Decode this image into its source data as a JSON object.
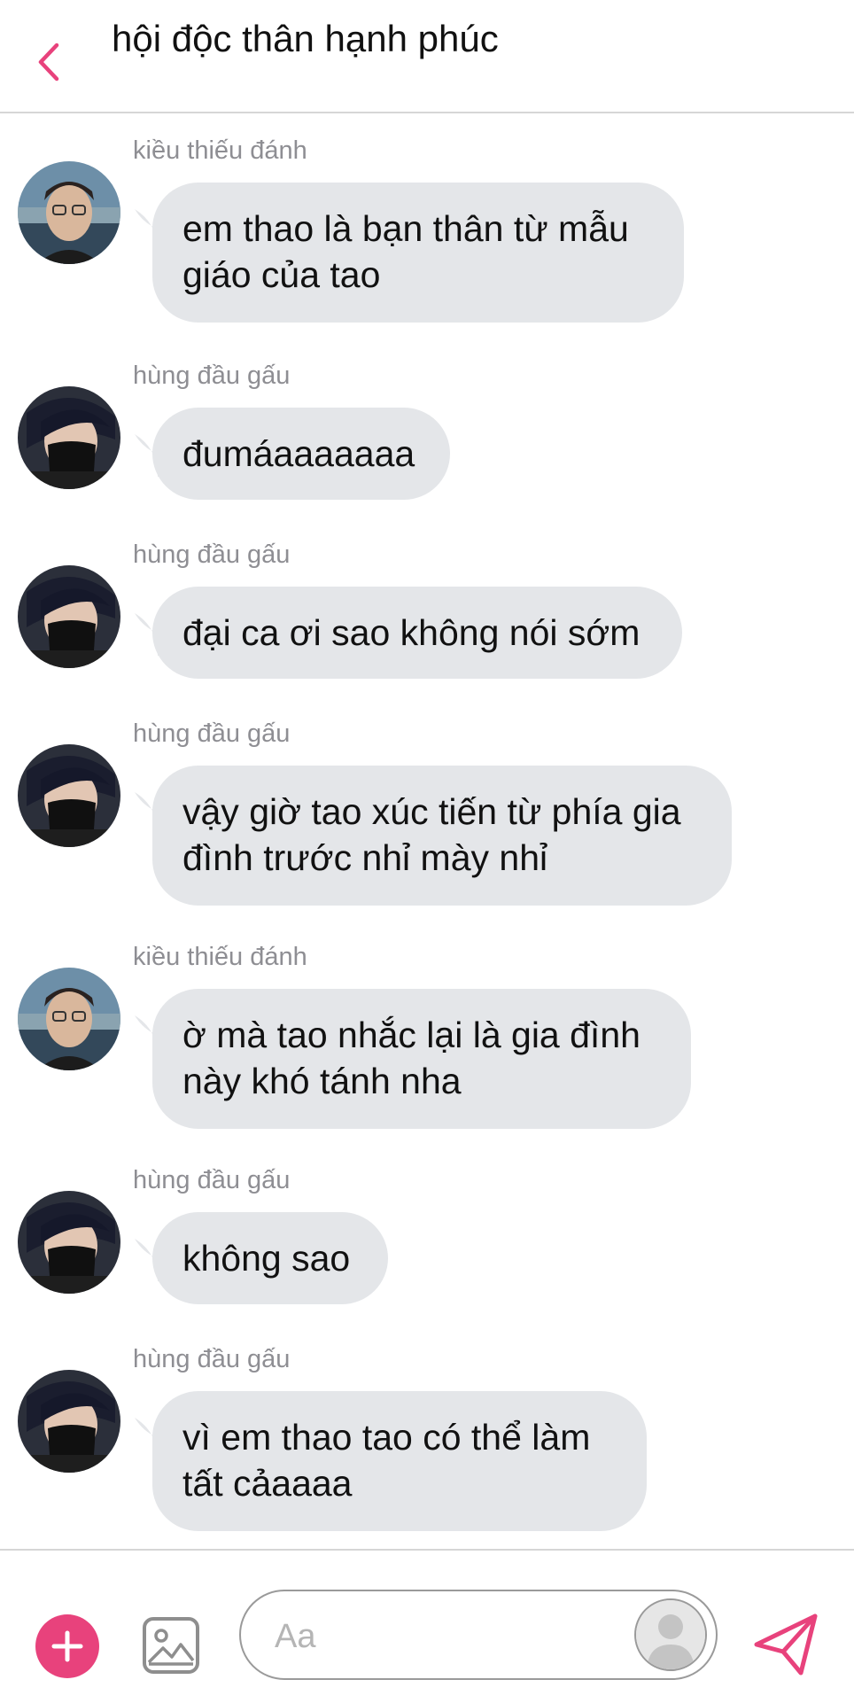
{
  "header": {
    "title": "hội độc thân hạnh phúc",
    "back_icon": "chevron-left-icon"
  },
  "colors": {
    "accent": "#e8427c",
    "bubble": "#e4e6e9",
    "sender_text": "#8e8e93",
    "divider": "#d6d6d6"
  },
  "messages": [
    {
      "sender": "kiều thiếu đánh",
      "text": "em thao là bạn thân từ mẫu\ngiáo của tao"
    },
    {
      "sender": "hùng đầu gấu",
      "text": "đumáaaaaaaa"
    },
    {
      "sender": "hùng đầu gấu",
      "text": "đại ca ơi sao không nói sớm"
    },
    {
      "sender": "hùng đầu gấu",
      "text": "vậy giờ tao xúc tiến từ phía gia\nđình trước nhỉ mày nhỉ"
    },
    {
      "sender": "kiều thiếu đánh",
      "text": "ờ mà tao nhắc lại là gia đình\nnày khó tánh nha"
    },
    {
      "sender": "hùng đầu gấu",
      "text": "không sao"
    },
    {
      "sender": "hùng đầu gấu",
      "text": "vì em thao tao có thể làm\ntất cảaaaa"
    }
  ],
  "composer": {
    "placeholder": "Aa",
    "plus_icon": "plus-icon",
    "image_icon": "image-icon",
    "send_icon": "send-icon"
  }
}
